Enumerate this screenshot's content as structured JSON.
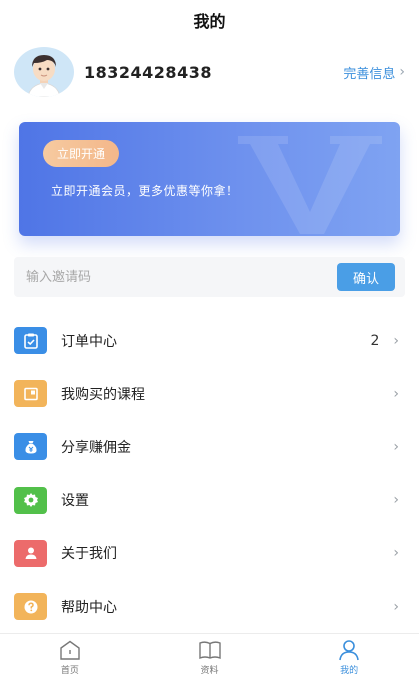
{
  "header": {
    "title": "我的"
  },
  "profile": {
    "username": "18324428438",
    "complete_label": "完善信息",
    "chevron": "›",
    "avatar_icon": "avatar-cartoon-boy"
  },
  "vip_card": {
    "button_label": "立即开通",
    "promo_text": "立即开通会员，更多优惠等你拿！",
    "watermark_glyph": "V",
    "colors": {
      "start": "#4f75e6",
      "end": "#7fa3f2",
      "button": "#f3b78a"
    }
  },
  "invite": {
    "placeholder": "输入邀请码",
    "value": "",
    "confirm_label": "确认"
  },
  "menu": {
    "items": [
      {
        "label": "订单中心",
        "count": "2",
        "icon": "clipboard-check-icon",
        "color": "#3a8ee6"
      },
      {
        "label": "我购买的课程",
        "count": "",
        "icon": "course-icon",
        "color": "#f2b45a"
      },
      {
        "label": "分享赚佣金",
        "count": "",
        "icon": "money-bag-icon",
        "color": "#3a8ee6"
      },
      {
        "label": "设置",
        "count": "",
        "icon": "gear-icon",
        "color": "#52c04a"
      },
      {
        "label": "关于我们",
        "count": "",
        "icon": "user-icon",
        "color": "#ec6b6b"
      },
      {
        "label": "帮助中心",
        "count": "",
        "icon": "help-icon",
        "color": "#f2b45a"
      }
    ],
    "chevron": "›"
  },
  "tabbar": {
    "tabs": [
      {
        "label": "首页",
        "icon": "home-icon",
        "active": false
      },
      {
        "label": "资料",
        "icon": "book-icon",
        "active": false
      },
      {
        "label": "我的",
        "icon": "person-icon",
        "active": true
      }
    ]
  }
}
